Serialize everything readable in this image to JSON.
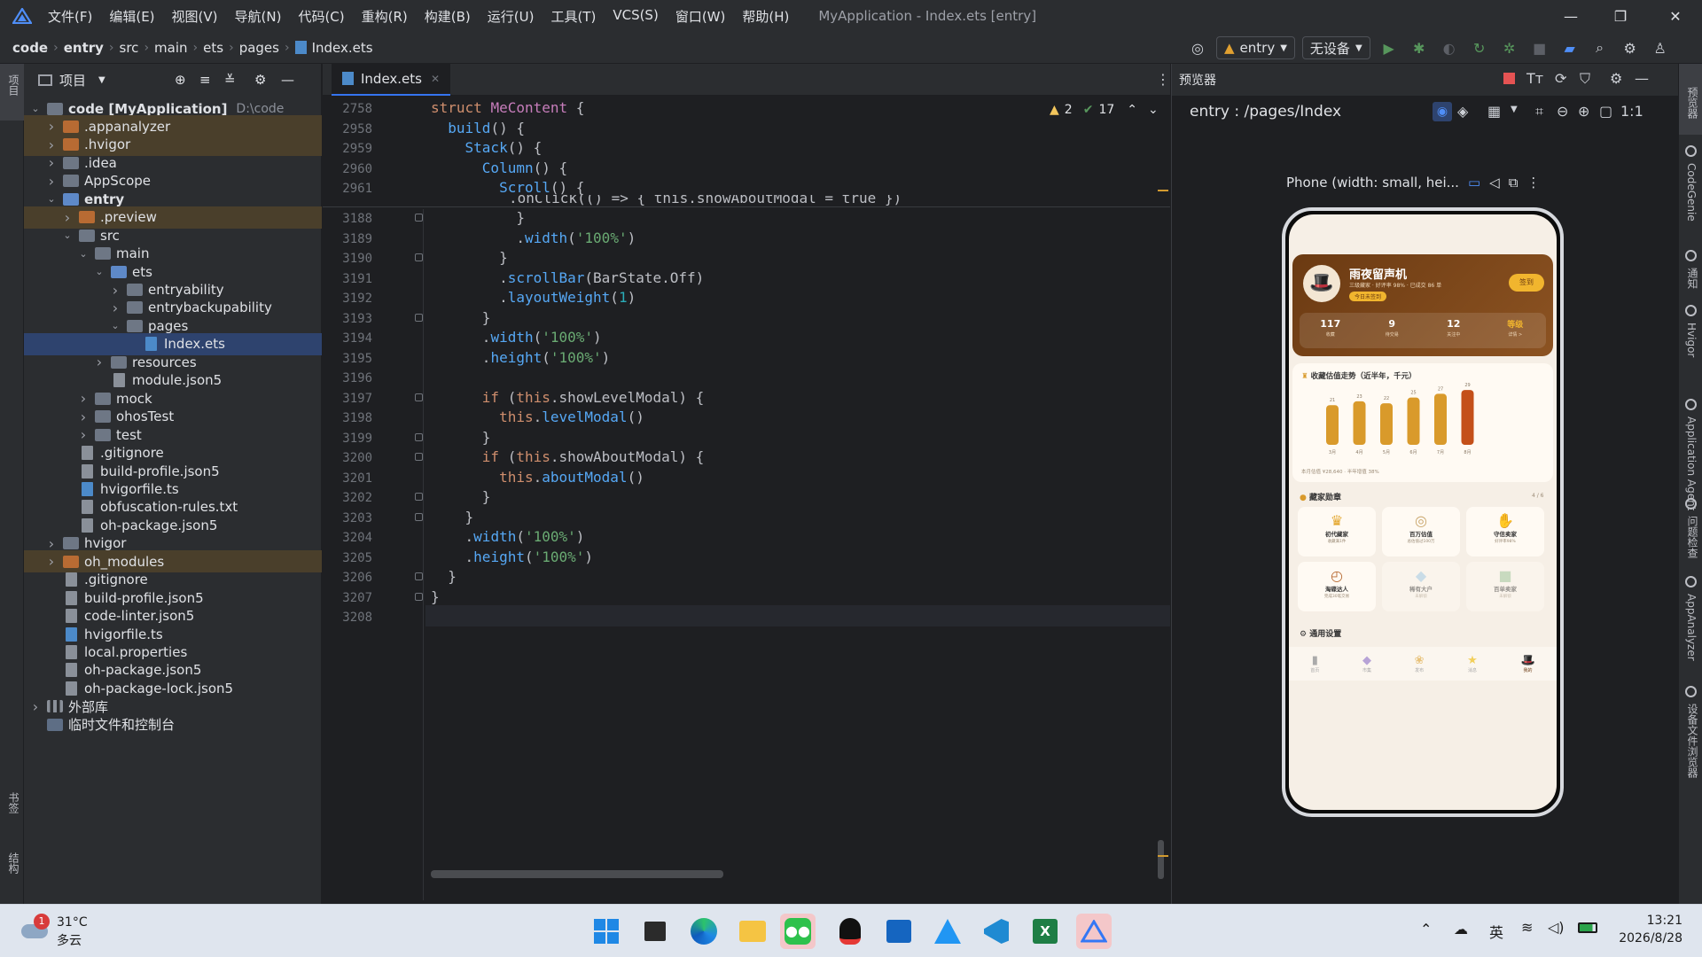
{
  "menubar": {
    "items": [
      "文件(F)",
      "编辑(E)",
      "视图(V)",
      "导航(N)",
      "代码(C)",
      "重构(R)",
      "构建(B)",
      "运行(U)",
      "工具(T)",
      "VCS(S)",
      "窗口(W)",
      "帮助(H)"
    ],
    "window_title": "MyApplication - Index.ets [entry]"
  },
  "breadcrumb": [
    "code",
    "entry",
    "src",
    "main",
    "ets",
    "pages",
    "Index.ets"
  ],
  "toolbar": {
    "module": "entry",
    "device": "无设备"
  },
  "left_strip": {
    "project": "项目",
    "bookmarks": "书签",
    "structure": "结构"
  },
  "project_panel": {
    "title": "项目",
    "tree": [
      {
        "name": "code [MyApplication]",
        "sub": "D:\\code",
        "depth": 0,
        "arrow": "v",
        "icon": "folder",
        "bold": true
      },
      {
        "name": ".appanalyzer",
        "depth": 1,
        "arrow": ">",
        "icon": "folder-orange",
        "hl": true
      },
      {
        "name": ".hvigor",
        "depth": 1,
        "arrow": ">",
        "icon": "folder-orange",
        "hl": true
      },
      {
        "name": ".idea",
        "depth": 1,
        "arrow": ">",
        "icon": "folder"
      },
      {
        "name": "AppScope",
        "depth": 1,
        "arrow": ">",
        "icon": "folder"
      },
      {
        "name": "entry",
        "depth": 1,
        "arrow": "v",
        "icon": "folder-blue",
        "bold": true
      },
      {
        "name": ".preview",
        "depth": 2,
        "arrow": ">",
        "icon": "folder-orange",
        "hl": true
      },
      {
        "name": "src",
        "depth": 2,
        "arrow": "v",
        "icon": "folder"
      },
      {
        "name": "main",
        "depth": 3,
        "arrow": "v",
        "icon": "folder"
      },
      {
        "name": "ets",
        "depth": 4,
        "arrow": "v",
        "icon": "folder-blue"
      },
      {
        "name": "entryability",
        "depth": 5,
        "arrow": ">",
        "icon": "folder"
      },
      {
        "name": "entrybackupability",
        "depth": 5,
        "arrow": ">",
        "icon": "folder"
      },
      {
        "name": "pages",
        "depth": 5,
        "arrow": "v",
        "icon": "folder"
      },
      {
        "name": "Index.ets",
        "depth": 6,
        "arrow": "",
        "icon": "file-ts",
        "sel": true
      },
      {
        "name": "resources",
        "depth": 4,
        "arrow": ">",
        "icon": "folder"
      },
      {
        "name": "module.json5",
        "depth": 4,
        "arrow": "",
        "icon": "file"
      },
      {
        "name": "mock",
        "depth": 3,
        "arrow": ">",
        "icon": "folder"
      },
      {
        "name": "ohosTest",
        "depth": 3,
        "arrow": ">",
        "icon": "folder"
      },
      {
        "name": "test",
        "depth": 3,
        "arrow": ">",
        "icon": "folder"
      },
      {
        "name": ".gitignore",
        "depth": 2,
        "arrow": "",
        "icon": "file"
      },
      {
        "name": "build-profile.json5",
        "depth": 2,
        "arrow": "",
        "icon": "file"
      },
      {
        "name": "hvigorfile.ts",
        "depth": 2,
        "arrow": "",
        "icon": "file-ts"
      },
      {
        "name": "obfuscation-rules.txt",
        "depth": 2,
        "arrow": "",
        "icon": "file"
      },
      {
        "name": "oh-package.json5",
        "depth": 2,
        "arrow": "",
        "icon": "file"
      },
      {
        "name": "hvigor",
        "depth": 1,
        "arrow": ">",
        "icon": "folder"
      },
      {
        "name": "oh_modules",
        "depth": 1,
        "arrow": ">",
        "icon": "folder-orange",
        "hl": true
      },
      {
        "name": ".gitignore",
        "depth": 1,
        "arrow": "",
        "icon": "file"
      },
      {
        "name": "build-profile.json5",
        "depth": 1,
        "arrow": "",
        "icon": "file"
      },
      {
        "name": "code-linter.json5",
        "depth": 1,
        "arrow": "",
        "icon": "file"
      },
      {
        "name": "hvigorfile.ts",
        "depth": 1,
        "arrow": "",
        "icon": "file-ts"
      },
      {
        "name": "local.properties",
        "depth": 1,
        "arrow": "",
        "icon": "file"
      },
      {
        "name": "oh-package.json5",
        "depth": 1,
        "arrow": "",
        "icon": "file"
      },
      {
        "name": "oh-package-lock.json5",
        "depth": 1,
        "arrow": "",
        "icon": "file"
      },
      {
        "name": "外部库",
        "depth": 0,
        "arrow": ">",
        "icon": "lib"
      },
      {
        "name": "临时文件和控制台",
        "depth": 0,
        "arrow": "",
        "icon": "console"
      }
    ]
  },
  "editor": {
    "tab": "Index.ets",
    "warnings": "2",
    "checks": "17",
    "sticky_lines": [
      {
        "n": "2758",
        "html": "<span class='kw'>struct</span> <span class='ty'>MeContent</span> {"
      },
      {
        "n": "2958",
        "html": "  <span class='fn'>build</span>() {"
      },
      {
        "n": "2959",
        "html": "    <span class='fn'>Stack</span>() {"
      },
      {
        "n": "2960",
        "html": "      <span class='fn'>Column</span>() {"
      },
      {
        "n": "2961",
        "html": "        <span class='fn'>Scroll</span>() {"
      }
    ],
    "partial_line": ".onClick(() => { this.showAboutModal = true })",
    "lines": [
      {
        "n": "3188",
        "html": "          }"
      },
      {
        "n": "3189",
        "html": "          .<span class='fn'>width</span>(<span class='st'>'100%'</span>)"
      },
      {
        "n": "3190",
        "html": "        }"
      },
      {
        "n": "3191",
        "html": "        .<span class='fn'>scrollBar</span>(BarState.Off)"
      },
      {
        "n": "3192",
        "html": "        .<span class='fn'>layoutWeight</span>(<span class='nm'>1</span>)"
      },
      {
        "n": "3193",
        "html": "      }"
      },
      {
        "n": "3194",
        "html": "      .<span class='fn'>width</span>(<span class='st'>'100%'</span>)"
      },
      {
        "n": "3195",
        "html": "      .<span class='fn'>height</span>(<span class='st'>'100%'</span>)"
      },
      {
        "n": "3196",
        "html": ""
      },
      {
        "n": "3197",
        "html": "      <span class='kw'>if</span> (<span class='kw'>this</span>.showLevelModal) {"
      },
      {
        "n": "3198",
        "html": "        <span class='kw'>this</span>.<span class='fn'>levelModal</span>()"
      },
      {
        "n": "3199",
        "html": "      }"
      },
      {
        "n": "3200",
        "html": "      <span class='kw'>if</span> (<span class='kw'>this</span>.showAboutModal) {"
      },
      {
        "n": "3201",
        "html": "        <span class='kw'>this</span>.<span class='fn'>aboutModal</span>()"
      },
      {
        "n": "3202",
        "html": "      }"
      },
      {
        "n": "3203",
        "html": "    }"
      },
      {
        "n": "3204",
        "html": "    .<span class='fn'>width</span>(<span class='st'>'100%'</span>)"
      },
      {
        "n": "3205",
        "html": "    .<span class='fn'>height</span>(<span class='st'>'100%'</span>)"
      },
      {
        "n": "3206",
        "html": "  }"
      },
      {
        "n": "3207",
        "html": "}"
      },
      {
        "n": "3208",
        "html": ""
      }
    ]
  },
  "previewer": {
    "title": "预览器",
    "route": "entry : /pages/Index",
    "device": "Phone (width: small, hei...",
    "app": {
      "name": "雨夜留声机",
      "info": "三级藏家 · 好评率 98% · 已成交 86 单",
      "tag": "今日未签到",
      "sign_btn": "签到",
      "stats": [
        {
          "value": "117",
          "label": "收藏"
        },
        {
          "value": "9",
          "label": "待交易"
        },
        {
          "value": "12",
          "label": "关注中"
        },
        {
          "value": "等级",
          "label": "详情 >"
        }
      ],
      "chart_title": "收藏估值走势（近半年，千元）",
      "chart_footer": "本月估值 ¥28,640 · 半年增值 38%",
      "badges_title": "藏家勋章",
      "badges_count": "4 / 6",
      "badges": [
        {
          "name": "初代藏家",
          "desc": "收藏满1件"
        },
        {
          "name": "百万估值",
          "desc": "总估值过100万"
        },
        {
          "name": "守信卖家",
          "desc": "好评率98%"
        },
        {
          "name": "淘碟达人",
          "desc": "完成30笔交易"
        },
        {
          "name": "稀有大户",
          "desc": "未解锁"
        },
        {
          "name": "百单卖家",
          "desc": "未解锁"
        }
      ],
      "settings_title": "通用设置",
      "nav": [
        "首页",
        "市集",
        "发布",
        "消息",
        "我的"
      ]
    }
  },
  "chart_data": {
    "type": "bar",
    "title": "收藏估值走势（近半年，千元）",
    "categories": [
      "3月",
      "4月",
      "5月",
      "6月",
      "7月",
      "8月"
    ],
    "values": [
      21,
      23,
      22,
      25,
      27,
      29
    ],
    "colors": [
      "#d99a2b",
      "#d99a2b",
      "#d99a2b",
      "#d99a2b",
      "#d99a2b",
      "#c4501a"
    ]
  },
  "right_strip": [
    "CodeGenie",
    "通知",
    "Hvigor",
    "Application Agent",
    "问题检查",
    "AppAnalyzer",
    "设备文件浏览器"
  ],
  "taskbar": {
    "weather_temp": "31°C",
    "weather_desc": "多云",
    "weather_badge": "1",
    "ime": "英",
    "time": "13:21",
    "date": "2026/8/28"
  }
}
